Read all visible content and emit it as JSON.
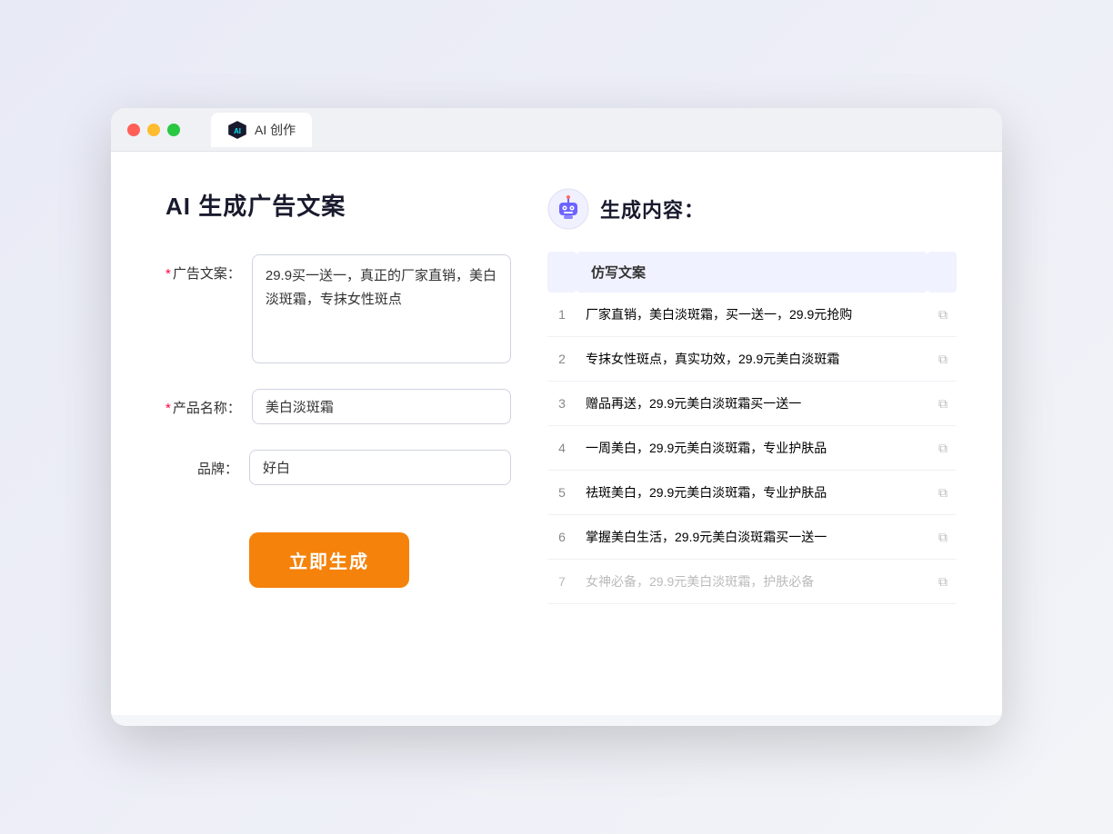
{
  "window": {
    "tab_label": "AI 创作"
  },
  "page": {
    "title": "AI 生成广告文案",
    "result_section_label": "生成内容："
  },
  "form": {
    "ad_copy_label": "广告文案：",
    "ad_copy_required": true,
    "ad_copy_value": "29.9买一送一，真正的厂家直销，美白淡斑霜，专抹女性斑点",
    "product_name_label": "产品名称：",
    "product_name_required": true,
    "product_name_value": "美白淡斑霜",
    "brand_label": "品牌：",
    "brand_required": false,
    "brand_value": "好白",
    "submit_label": "立即生成"
  },
  "result": {
    "table_header": "仿写文案",
    "items": [
      {
        "num": "1",
        "text": "厂家直销，美白淡斑霜，买一送一，29.9元抢购",
        "faded": false
      },
      {
        "num": "2",
        "text": "专抹女性斑点，真实功效，29.9元美白淡斑霜",
        "faded": false
      },
      {
        "num": "3",
        "text": "赠品再送，29.9元美白淡斑霜买一送一",
        "faded": false
      },
      {
        "num": "4",
        "text": "一周美白，29.9元美白淡斑霜，专业护肤品",
        "faded": false
      },
      {
        "num": "5",
        "text": "祛斑美白，29.9元美白淡斑霜，专业护肤品",
        "faded": false
      },
      {
        "num": "6",
        "text": "掌握美白生活，29.9元美白淡斑霜买一送一",
        "faded": false
      },
      {
        "num": "7",
        "text": "女神必备，29.9元美白淡斑霜，护肤必备",
        "faded": true
      }
    ]
  }
}
